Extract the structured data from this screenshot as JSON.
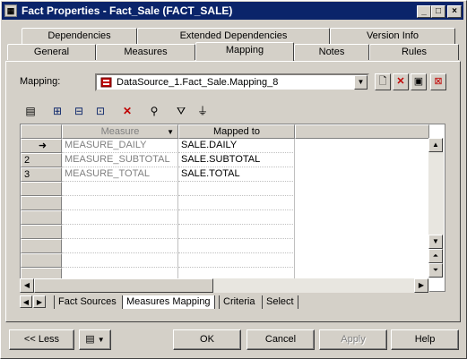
{
  "window": {
    "title": "Fact Properties - Fact_Sale (FACT_SALE)",
    "min": "_",
    "max": "□",
    "close": "×"
  },
  "tabs_row1": [
    "Dependencies",
    "Extended Dependencies",
    "Version Info"
  ],
  "tabs_row2": [
    "General",
    "Measures",
    "Mapping",
    "Notes",
    "Rules"
  ],
  "active_tab": "Mapping",
  "mapping": {
    "label": "Mapping:",
    "value": "DataSource_1.Fact_Sale.Mapping_8"
  },
  "grid": {
    "columns": [
      "Measure",
      "Mapped to"
    ],
    "rows": [
      {
        "marker": "➜",
        "measure": "MEASURE_DAILY",
        "mapped": "SALE.DAILY"
      },
      {
        "marker": "2",
        "measure": "MEASURE_SUBTOTAL",
        "mapped": "SALE.SUBTOTAL"
      },
      {
        "marker": "3",
        "measure": "MEASURE_TOTAL",
        "mapped": "SALE.TOTAL"
      }
    ]
  },
  "subtabs": [
    "Fact Sources",
    "Measures Mapping",
    "Criteria",
    "Select"
  ],
  "active_subtab": "Measures Mapping",
  "buttons": {
    "less": "<< Less",
    "ok": "OK",
    "cancel": "Cancel",
    "apply": "Apply",
    "help": "Help"
  },
  "colors": {
    "titlebar": "#0a246a",
    "face": "#d4d0c8",
    "disabled_text": "#808080"
  }
}
